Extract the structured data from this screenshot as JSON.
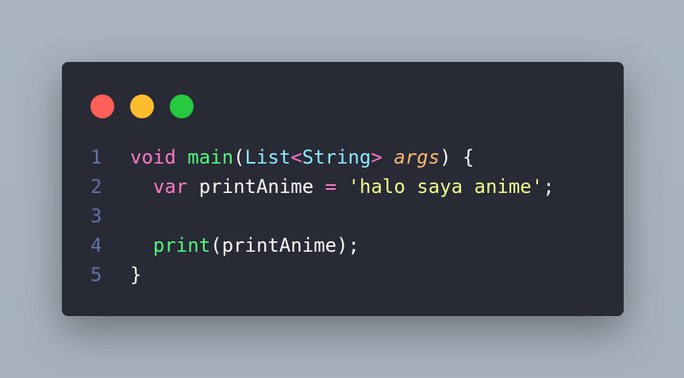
{
  "colors": {
    "window_bg": "#282a36",
    "dot_close": "#ff5f56",
    "dot_minimize": "#ffbd2e",
    "dot_maximize": "#27c93f",
    "keyword": "#ff79c6",
    "function": "#50fa7b",
    "type": "#8be9fd",
    "param": "#ffb86c",
    "string": "#f1fa8c",
    "plain": "#f8f8f2",
    "line_number": "#6272a4"
  },
  "code": {
    "language": "dart",
    "lines": [
      {
        "number": "1",
        "tokens": [
          {
            "text": "void",
            "color": "#ff79c6",
            "style": ""
          },
          {
            "text": " ",
            "color": "#f8f8f2",
            "style": ""
          },
          {
            "text": "main",
            "color": "#50fa7b",
            "style": ""
          },
          {
            "text": "(",
            "color": "#f8f8f2",
            "style": ""
          },
          {
            "text": "List",
            "color": "#8be9fd",
            "style": ""
          },
          {
            "text": "<",
            "color": "#ff79c6",
            "style": ""
          },
          {
            "text": "String",
            "color": "#8be9fd",
            "style": ""
          },
          {
            "text": ">",
            "color": "#ff79c6",
            "style": ""
          },
          {
            "text": " ",
            "color": "#f8f8f2",
            "style": ""
          },
          {
            "text": "args",
            "color": "#ffb86c",
            "style": "italic"
          },
          {
            "text": ") {",
            "color": "#f8f8f2",
            "style": ""
          }
        ]
      },
      {
        "number": "2",
        "tokens": [
          {
            "text": "  ",
            "color": "#f8f8f2",
            "style": ""
          },
          {
            "text": "var",
            "color": "#ff79c6",
            "style": ""
          },
          {
            "text": " printAnime ",
            "color": "#f8f8f2",
            "style": ""
          },
          {
            "text": "=",
            "color": "#ff79c6",
            "style": ""
          },
          {
            "text": " ",
            "color": "#f8f8f2",
            "style": ""
          },
          {
            "text": "'halo saya anime'",
            "color": "#f1fa8c",
            "style": ""
          },
          {
            "text": ";",
            "color": "#f8f8f2",
            "style": ""
          }
        ]
      },
      {
        "number": "3",
        "tokens": []
      },
      {
        "number": "4",
        "tokens": [
          {
            "text": "  ",
            "color": "#f8f8f2",
            "style": ""
          },
          {
            "text": "print",
            "color": "#50fa7b",
            "style": ""
          },
          {
            "text": "(printAnime);",
            "color": "#f8f8f2",
            "style": ""
          }
        ]
      },
      {
        "number": "5",
        "tokens": [
          {
            "text": "}",
            "color": "#f8f8f2",
            "style": ""
          }
        ]
      }
    ]
  }
}
